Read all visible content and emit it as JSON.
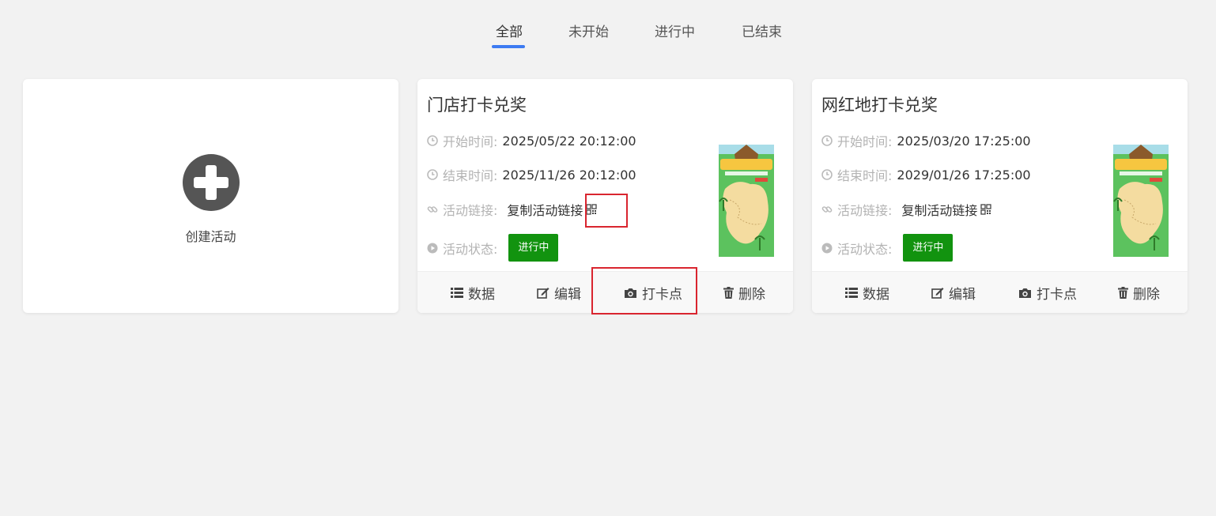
{
  "tabs": [
    {
      "label": "全部",
      "active": true
    },
    {
      "label": "未开始",
      "active": false
    },
    {
      "label": "进行中",
      "active": false
    },
    {
      "label": "已结束",
      "active": false
    }
  ],
  "create_card": {
    "label": "创建活动",
    "icon": "plus-circle-icon"
  },
  "field_labels": {
    "start": "开始时间:",
    "end": "结束时间:",
    "link": "活动链接:",
    "status": "活动状态:"
  },
  "activities": [
    {
      "title": "门店打卡兑奖",
      "start_time": "2025/05/22 20:12:00",
      "end_time": "2025/11/26 20:12:00",
      "link_text": "复制活动链接",
      "status": "进行中",
      "actions": [
        "数据",
        "编辑",
        "打卡点",
        "删除"
      ]
    },
    {
      "title": "网红地打卡兑奖",
      "start_time": "2025/03/20 17:25:00",
      "end_time": "2029/01/26 17:25:00",
      "link_text": "复制活动链接",
      "status": "进行中",
      "actions": [
        "数据",
        "编辑",
        "打卡点",
        "删除"
      ]
    }
  ],
  "poster": {
    "icon": "check-in-map-poster"
  },
  "colors": {
    "accent": "#3d7bf2",
    "status_green": "#12930f",
    "highlight": "#d9252f",
    "background": "#f2f2f2"
  }
}
